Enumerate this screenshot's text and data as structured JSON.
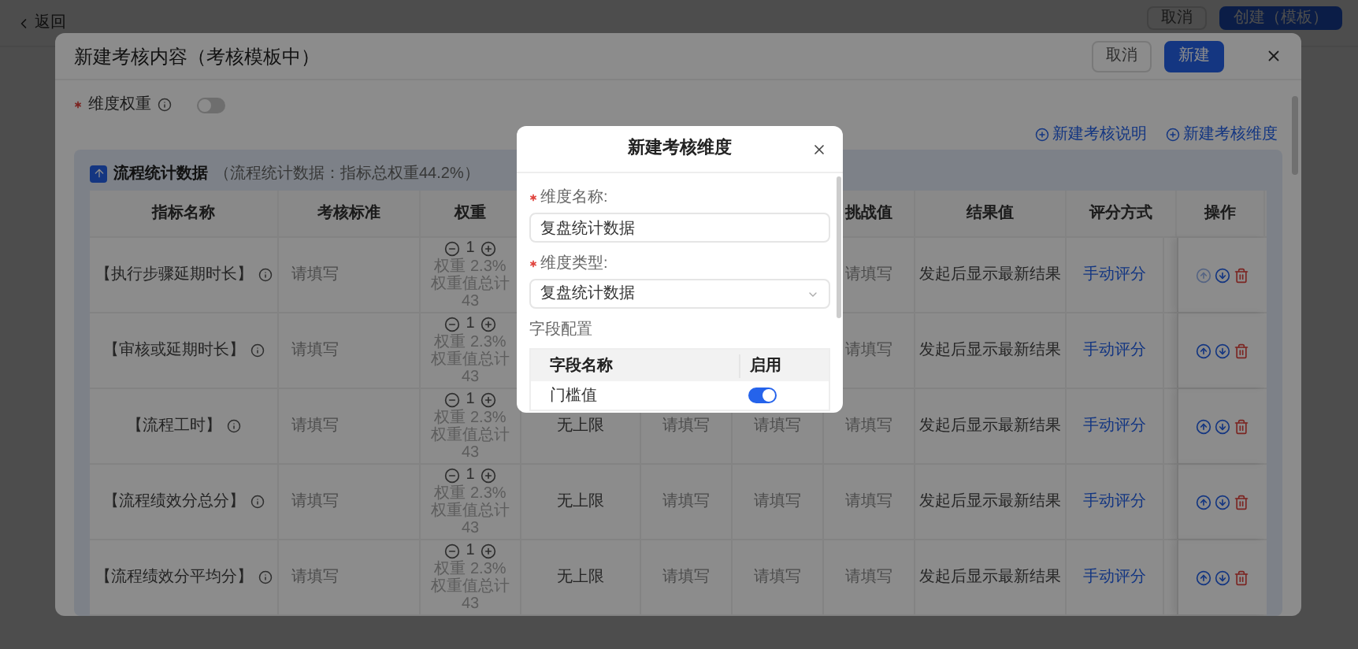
{
  "background": {
    "back_link": "返回",
    "buttons": [
      {
        "label": "取消",
        "kind": "default"
      },
      {
        "label": "创建（模板）",
        "kind": "primary"
      }
    ]
  },
  "modal": {
    "title": "新建考核内容（考核模板中）",
    "buttons": [
      {
        "label": "取消",
        "kind": "default"
      },
      {
        "label": "新建",
        "kind": "primary"
      }
    ],
    "weight_switch": {
      "label": "维度权重",
      "required": true,
      "on": false
    },
    "links": [
      "新建考核说明",
      "新建考核维度"
    ],
    "section": {
      "title": "流程统计数据",
      "summary": "（流程统计数据：指标总权重44.2%）"
    },
    "table": {
      "columns": [
        "指标名称",
        "考核标准",
        "权重",
        "挑战值",
        "结果值",
        "评分方式",
        "操作"
      ],
      "rows": [
        {
          "name": "【执行步骤延期时长】",
          "standard": "请填写",
          "weight": "1",
          "weight_share": "权重 2.3%",
          "weight_total": "权重值总计 43",
          "challenge": "请填写",
          "result": "发起后显示最新结果",
          "scoring": "手动评分",
          "move_up_enabled": false
        },
        {
          "name": "【审核或延期时长】",
          "standard": "请填写",
          "weight": "1",
          "weight_share": "权重 2.3%",
          "weight_total": "权重值总计 43",
          "challenge": "请填写",
          "result": "发起后显示最新结果",
          "scoring": "手动评分",
          "move_up_enabled": true
        },
        {
          "name": "【流程工时】",
          "standard": "请填写",
          "weight": "1",
          "weight_share": "权重 2.3%",
          "weight_total": "权重值总计 43",
          "column_4": "无上限",
          "column_5": "请填写",
          "column_6": "请填写",
          "challenge": "请填写",
          "result": "发起后显示最新结果",
          "scoring": "手动评分",
          "move_up_enabled": true
        },
        {
          "name": "【流程绩效分总分】",
          "standard": "请填写",
          "weight": "1",
          "weight_share": "权重 2.3%",
          "weight_total": "权重值总计 43",
          "column_4": "无上限",
          "column_5": "请填写",
          "column_6": "请填写",
          "challenge": "请填写",
          "result": "发起后显示最新结果",
          "scoring": "手动评分",
          "move_up_enabled": true
        },
        {
          "name": "【流程绩效分平均分】",
          "standard": "请填写",
          "weight": "1",
          "weight_share": "权重 2.3%",
          "weight_total": "权重值总计 43",
          "column_4": "无上限",
          "column_5": "请填写",
          "column_6": "请填写",
          "challenge": "请填写",
          "result": "发起后显示最新结果",
          "scoring": "手动评分",
          "move_up_enabled": true
        }
      ]
    }
  },
  "dialog": {
    "title": "新建考核维度",
    "fields": [
      {
        "label": "维度名称:",
        "required": true,
        "kind": "input",
        "value": "复盘统计数据"
      },
      {
        "label": "维度类型:",
        "required": true,
        "kind": "select",
        "value": "复盘统计数据"
      }
    ],
    "field_config": {
      "title": "字段配置",
      "columns": [
        "字段名称",
        "启用"
      ],
      "rows": [
        {
          "name": "门槛值",
          "enabled": true
        }
      ]
    }
  }
}
